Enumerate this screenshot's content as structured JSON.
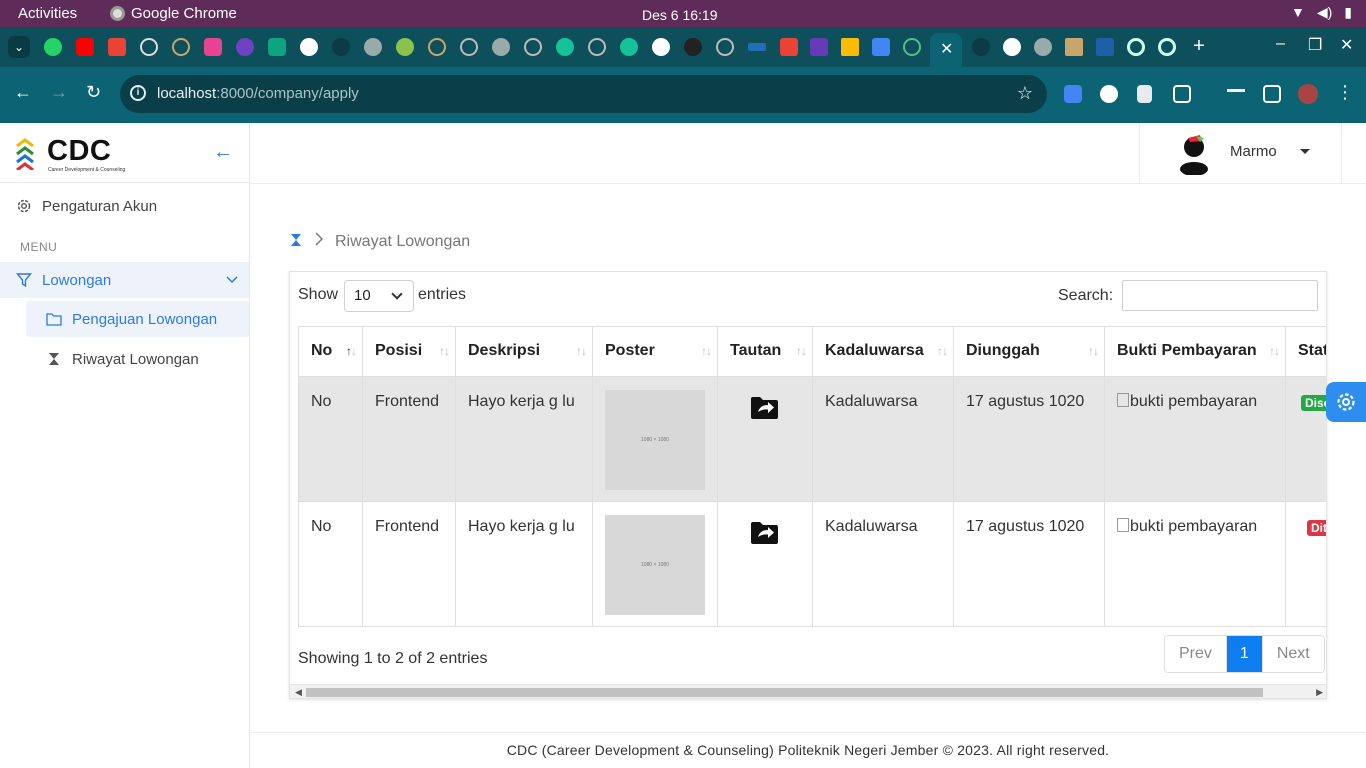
{
  "system": {
    "activities": "Activities",
    "app_name": "Google Chrome",
    "clock": "Des 6  16:19"
  },
  "browser": {
    "url_host": "localhost",
    "url_path": ":8000/company/apply"
  },
  "sidebar": {
    "logo_text": "CDC",
    "logo_subtitle": "Career Development & Counseling",
    "settings_label": "Pengaturan Akun",
    "menu_heading": "MENU",
    "parent_item": "Lowongan",
    "items": [
      {
        "label": "Pengajuan Lowongan"
      },
      {
        "label": "Riwayat Lowongan"
      }
    ]
  },
  "header": {
    "username": "Marmo"
  },
  "breadcrumb": {
    "current": "Riwayat Lowongan"
  },
  "table_controls": {
    "show_label": "Show",
    "page_size": "10",
    "entries_label": "entries",
    "search_label": "Search:"
  },
  "table": {
    "columns": [
      "No",
      "Posisi",
      "Deskripsi",
      "Poster",
      "Tautan",
      "Kadaluwarsa",
      "Diunggah",
      "Bukti Pembayaran",
      "Status"
    ],
    "rows": [
      {
        "no": "No",
        "posisi": "Frontend",
        "deskripsi": "Hayo kerja g lu",
        "poster": "1080 × 1080",
        "kadaluwarsa": "Kadaluwarsa",
        "diunggah": "17 agustus 1020",
        "bukti": "bukti pembayaran",
        "status": "Disetujui",
        "status_color": "#28a745"
      },
      {
        "no": "No",
        "posisi": "Frontend",
        "deskripsi": "Hayo kerja g lu",
        "poster": "1080 × 1080",
        "kadaluwarsa": "Kadaluwarsa",
        "diunggah": "17 agustus 1020",
        "bukti": "bukti pembayaran",
        "status": "Ditolak",
        "status_color": "#dc3545"
      }
    ]
  },
  "pagination": {
    "info": "Showing 1 to 2 of 2 entries",
    "prev": "Prev",
    "current": "1",
    "next": "Next"
  },
  "footer": {
    "text": "CDC (Career Development & Counseling) Politeknik Negeri Jember © 2023. All right reserved."
  },
  "colors": {
    "accent": "#2d7be0",
    "tab_strip": "#0d4f5a",
    "toolbar": "#0b6374",
    "gnome_bar": "#5f2c5a"
  }
}
